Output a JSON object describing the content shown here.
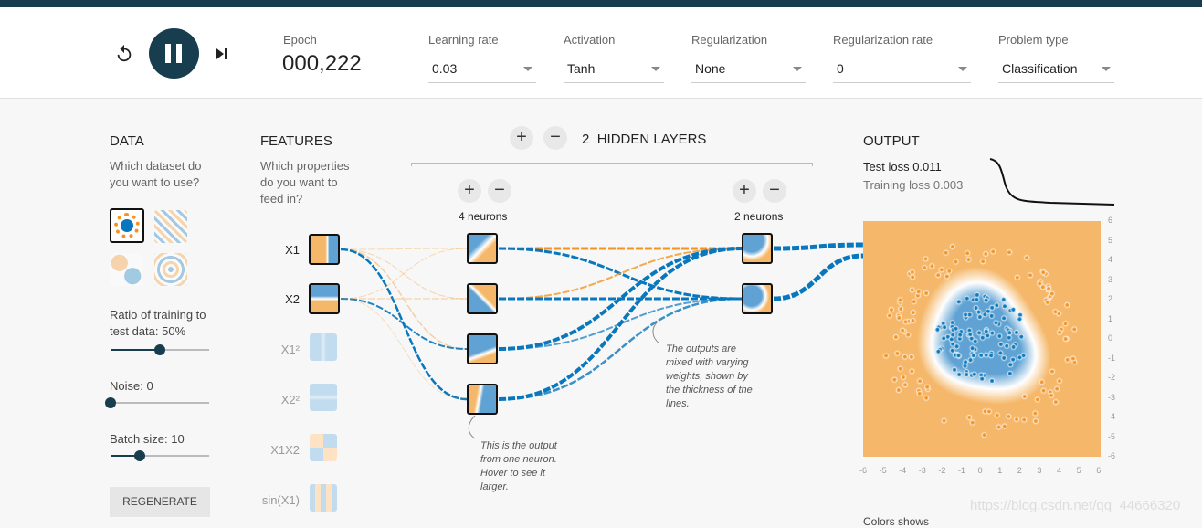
{
  "header": {
    "epoch_label": "Epoch",
    "epoch_value": "000,222",
    "controls": [
      {
        "label": "Learning rate",
        "value": "0.03"
      },
      {
        "label": "Activation",
        "value": "Tanh"
      },
      {
        "label": "Regularization",
        "value": "None"
      },
      {
        "label": "Regularization rate",
        "value": "0"
      },
      {
        "label": "Problem type",
        "value": "Classification"
      }
    ]
  },
  "data": {
    "title": "DATA",
    "question": "Which dataset do you want to use?",
    "ratio_label": "Ratio of training to test data:",
    "ratio_value": "50%",
    "ratio_fraction": 0.5,
    "noise_label": "Noise:",
    "noise_value": "0",
    "noise_fraction": 0,
    "batch_label": "Batch size:",
    "batch_value": "10",
    "batch_fraction": 0.3,
    "regenerate": "REGENERATE",
    "selected_dataset": "circle"
  },
  "features": {
    "title": "FEATURES",
    "question": "Which properties do you want to feed in?",
    "items": [
      {
        "label": "X1",
        "active": true
      },
      {
        "label": "X2",
        "active": true
      },
      {
        "label": "X1²",
        "active": false
      },
      {
        "label": "X2²",
        "active": false
      },
      {
        "label": "X1X2",
        "active": false
      },
      {
        "label": "sin(X1)",
        "active": false
      }
    ]
  },
  "network": {
    "hidden_layers_count": "2",
    "hidden_layers_label": "HIDDEN LAYERS",
    "layers": [
      {
        "neurons": "4 neurons"
      },
      {
        "neurons": "2 neurons"
      }
    ],
    "note_neuron": "This is the output from one neuron. Hover to see it larger.",
    "note_weights": "The outputs are mixed with varying weights, shown by the thickness of the lines."
  },
  "output": {
    "title": "OUTPUT",
    "test_loss_label": "Test loss",
    "test_loss": "0.011",
    "train_loss_label": "Training loss",
    "train_loss": "0.003",
    "axis_ticks": [
      "6",
      "5",
      "4",
      "3",
      "2",
      "1",
      "0",
      "-1",
      "-2",
      "-3",
      "-4",
      "-5",
      "-6"
    ],
    "bottom_ticks": [
      "-6",
      "-5",
      "-4",
      "-3",
      "-2",
      "-1",
      "0",
      "1",
      "2",
      "3",
      "4",
      "5",
      "6"
    ],
    "colors_label": "Colors shows"
  },
  "colors": {
    "orange": "#f59322",
    "blue": "#0877bd",
    "dark": "#183d4e"
  },
  "watermark": "https://blog.csdn.net/qq_44666320"
}
